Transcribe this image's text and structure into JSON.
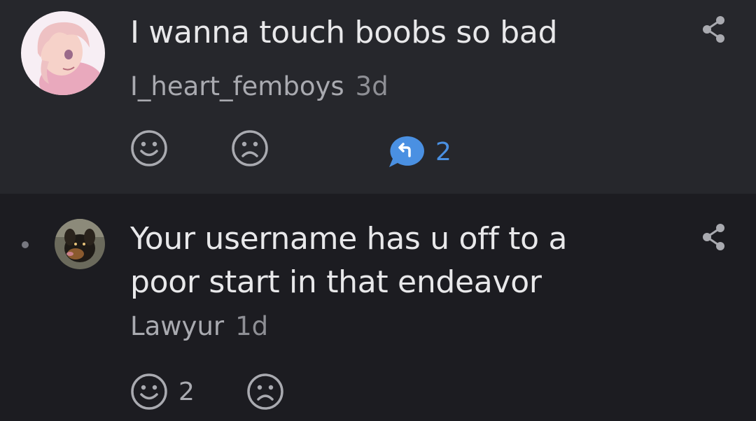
{
  "comments": [
    {
      "text": "I wanna touch boobs so bad",
      "username": "I_heart_femboys",
      "age": "3d",
      "like_count": "",
      "reply_count": "2",
      "avatar_icon": "anime-girl-avatar"
    },
    {
      "text_line1": "Your username has u off to a",
      "text_line2": "poor start in that endeavor",
      "username": "Lawyur",
      "age": "1d",
      "like_count": "2",
      "avatar_icon": "dog-avatar"
    }
  ],
  "colors": {
    "post_bg": "#26272c",
    "reply_bg": "#1c1c21",
    "accent_blue": "#4a90e2",
    "icon_gray": "#a9aab0"
  }
}
